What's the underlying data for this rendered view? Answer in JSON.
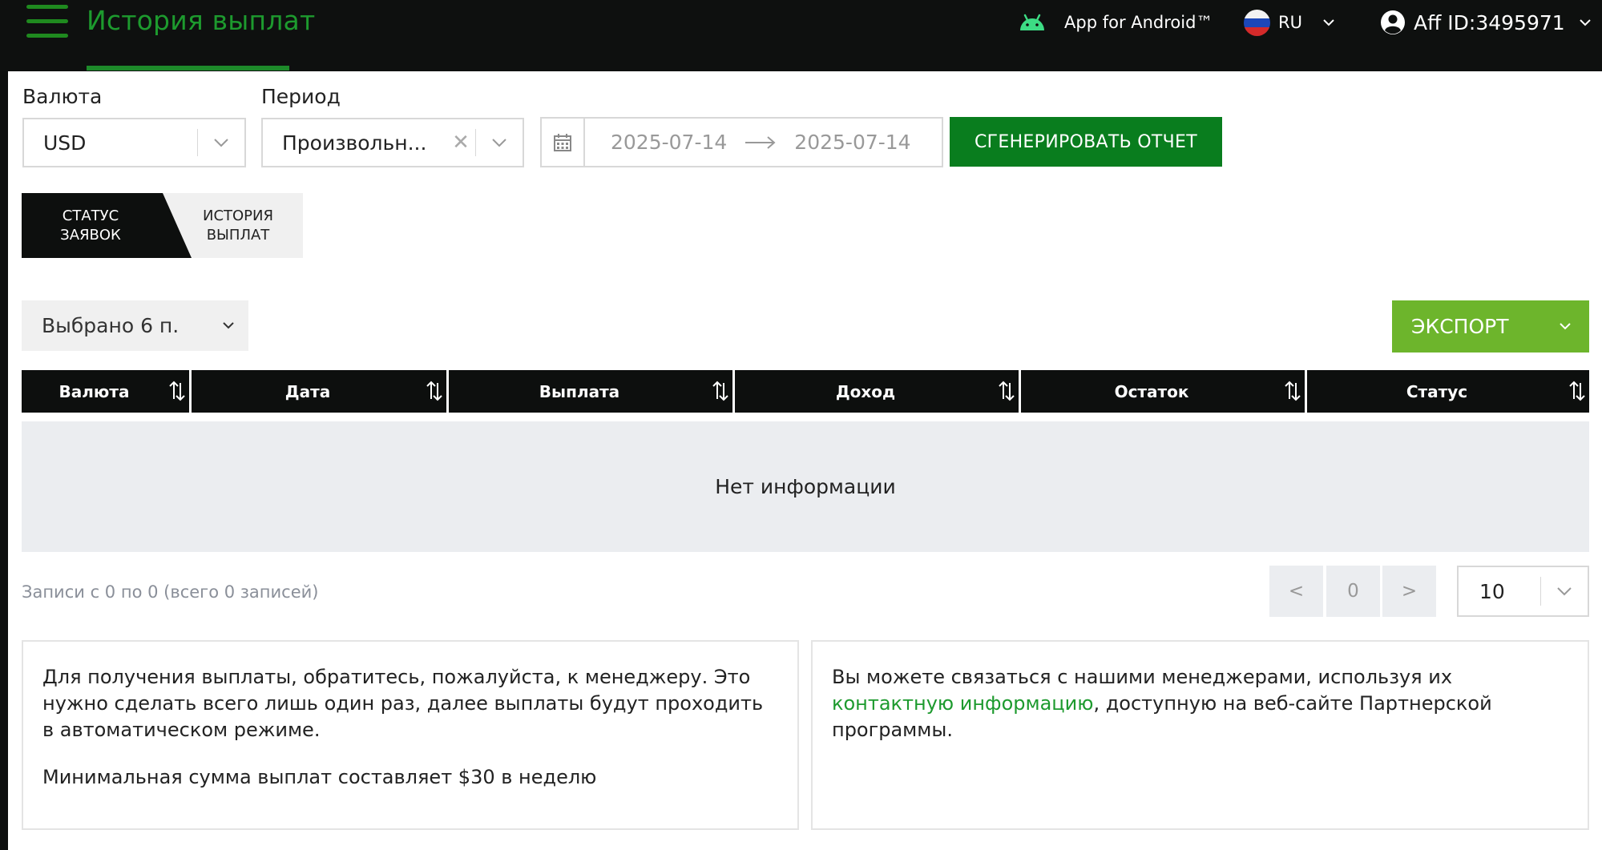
{
  "header": {
    "title": "История выплат",
    "android_label": "App for Android™",
    "language": "RU",
    "aff_id": "Aff ID:3495971"
  },
  "filters": {
    "currency_label": "Валюта",
    "currency_value": "USD",
    "period_label": "Период",
    "period_value": "Произвольн...",
    "date_from": "2025-07-14",
    "date_to": "2025-07-14",
    "generate_label": "СГЕНЕРИРОВАТЬ ОТЧЕТ"
  },
  "tabs": [
    {
      "label": "СТАТУС ЗАЯВОК",
      "active": true
    },
    {
      "label": "ИСТОРИЯ ВЫПЛАТ",
      "active": false
    }
  ],
  "toolbar": {
    "columns_selected": "Выбрано 6 п.",
    "export_label": "ЭКСПОРТ"
  },
  "table": {
    "columns": [
      "Валюта",
      "Дата",
      "Выплата",
      "Доход",
      "Остаток",
      "Статус"
    ],
    "rows": [],
    "empty_text": "Нет информации"
  },
  "pagination": {
    "records_info": "Записи с 0 по 0 (всего 0 записей)",
    "prev": "<",
    "page": "0",
    "next": ">",
    "per_page": "10"
  },
  "info": {
    "left_p1": "Для получения выплаты, обратитесь, пожалуйста, к менеджеру. Это нужно сделать всего лишь один раз, далее выплаты будут проходить в автоматическом режиме.",
    "left_p2": "Минимальная сумма выплат составляет $30 в неделю",
    "right_before": "Вы можете связаться с нашими менеджерами, используя их ",
    "right_link": "контактную информацию",
    "right_after": ", доступную на веб-сайте Партнерской программы."
  },
  "colors": {
    "brand_green": "#1d9a2e",
    "button_green": "#097d1e",
    "export_green": "#6db52c",
    "dark": "#0d0f0e",
    "android_green": "#3ddc84"
  }
}
